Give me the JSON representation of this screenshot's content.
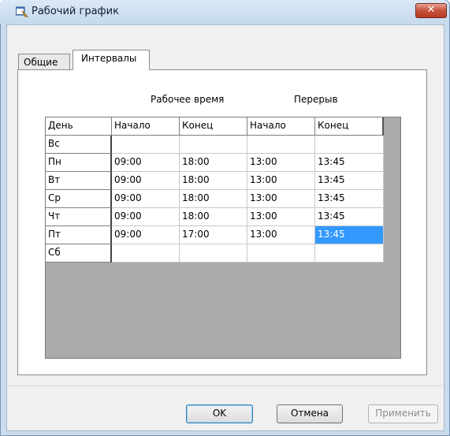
{
  "window": {
    "title": "Рабочий график",
    "close_label": "✕"
  },
  "tabs": [
    {
      "label": "Общие",
      "active": false
    },
    {
      "label": "Интервалы",
      "active": true
    }
  ],
  "group_labels": {
    "work_time": "Рабочее время",
    "break": "Перерыв"
  },
  "table": {
    "columns": [
      "День",
      "Начало",
      "Конец",
      "Начало",
      "Конец"
    ],
    "rows": [
      {
        "day": "Вс",
        "work_start": "",
        "work_end": "",
        "break_start": "",
        "break_end": ""
      },
      {
        "day": "Пн",
        "work_start": "09:00",
        "work_end": "18:00",
        "break_start": "13:00",
        "break_end": "13:45"
      },
      {
        "day": "Вт",
        "work_start": "09:00",
        "work_end": "18:00",
        "break_start": "13:00",
        "break_end": "13:45"
      },
      {
        "day": "Ср",
        "work_start": "09:00",
        "work_end": "18:00",
        "break_start": "13:00",
        "break_end": "13:45"
      },
      {
        "day": "Чт",
        "work_start": "09:00",
        "work_end": "18:00",
        "break_start": "13:00",
        "break_end": "13:45"
      },
      {
        "day": "Пт",
        "work_start": "09:00",
        "work_end": "17:00",
        "break_start": "13:00",
        "break_end": "13:45"
      },
      {
        "day": "Сб",
        "work_start": "",
        "work_end": "",
        "break_start": "",
        "break_end": ""
      }
    ],
    "selected_cell": {
      "row": 5,
      "field": "break_end"
    }
  },
  "buttons": {
    "ok": "OK",
    "cancel": "Отмена",
    "apply": "Применить"
  },
  "colors": {
    "selection": "#3399ff",
    "close_button": "#c7503b",
    "title_bar": "#c9dcef"
  }
}
